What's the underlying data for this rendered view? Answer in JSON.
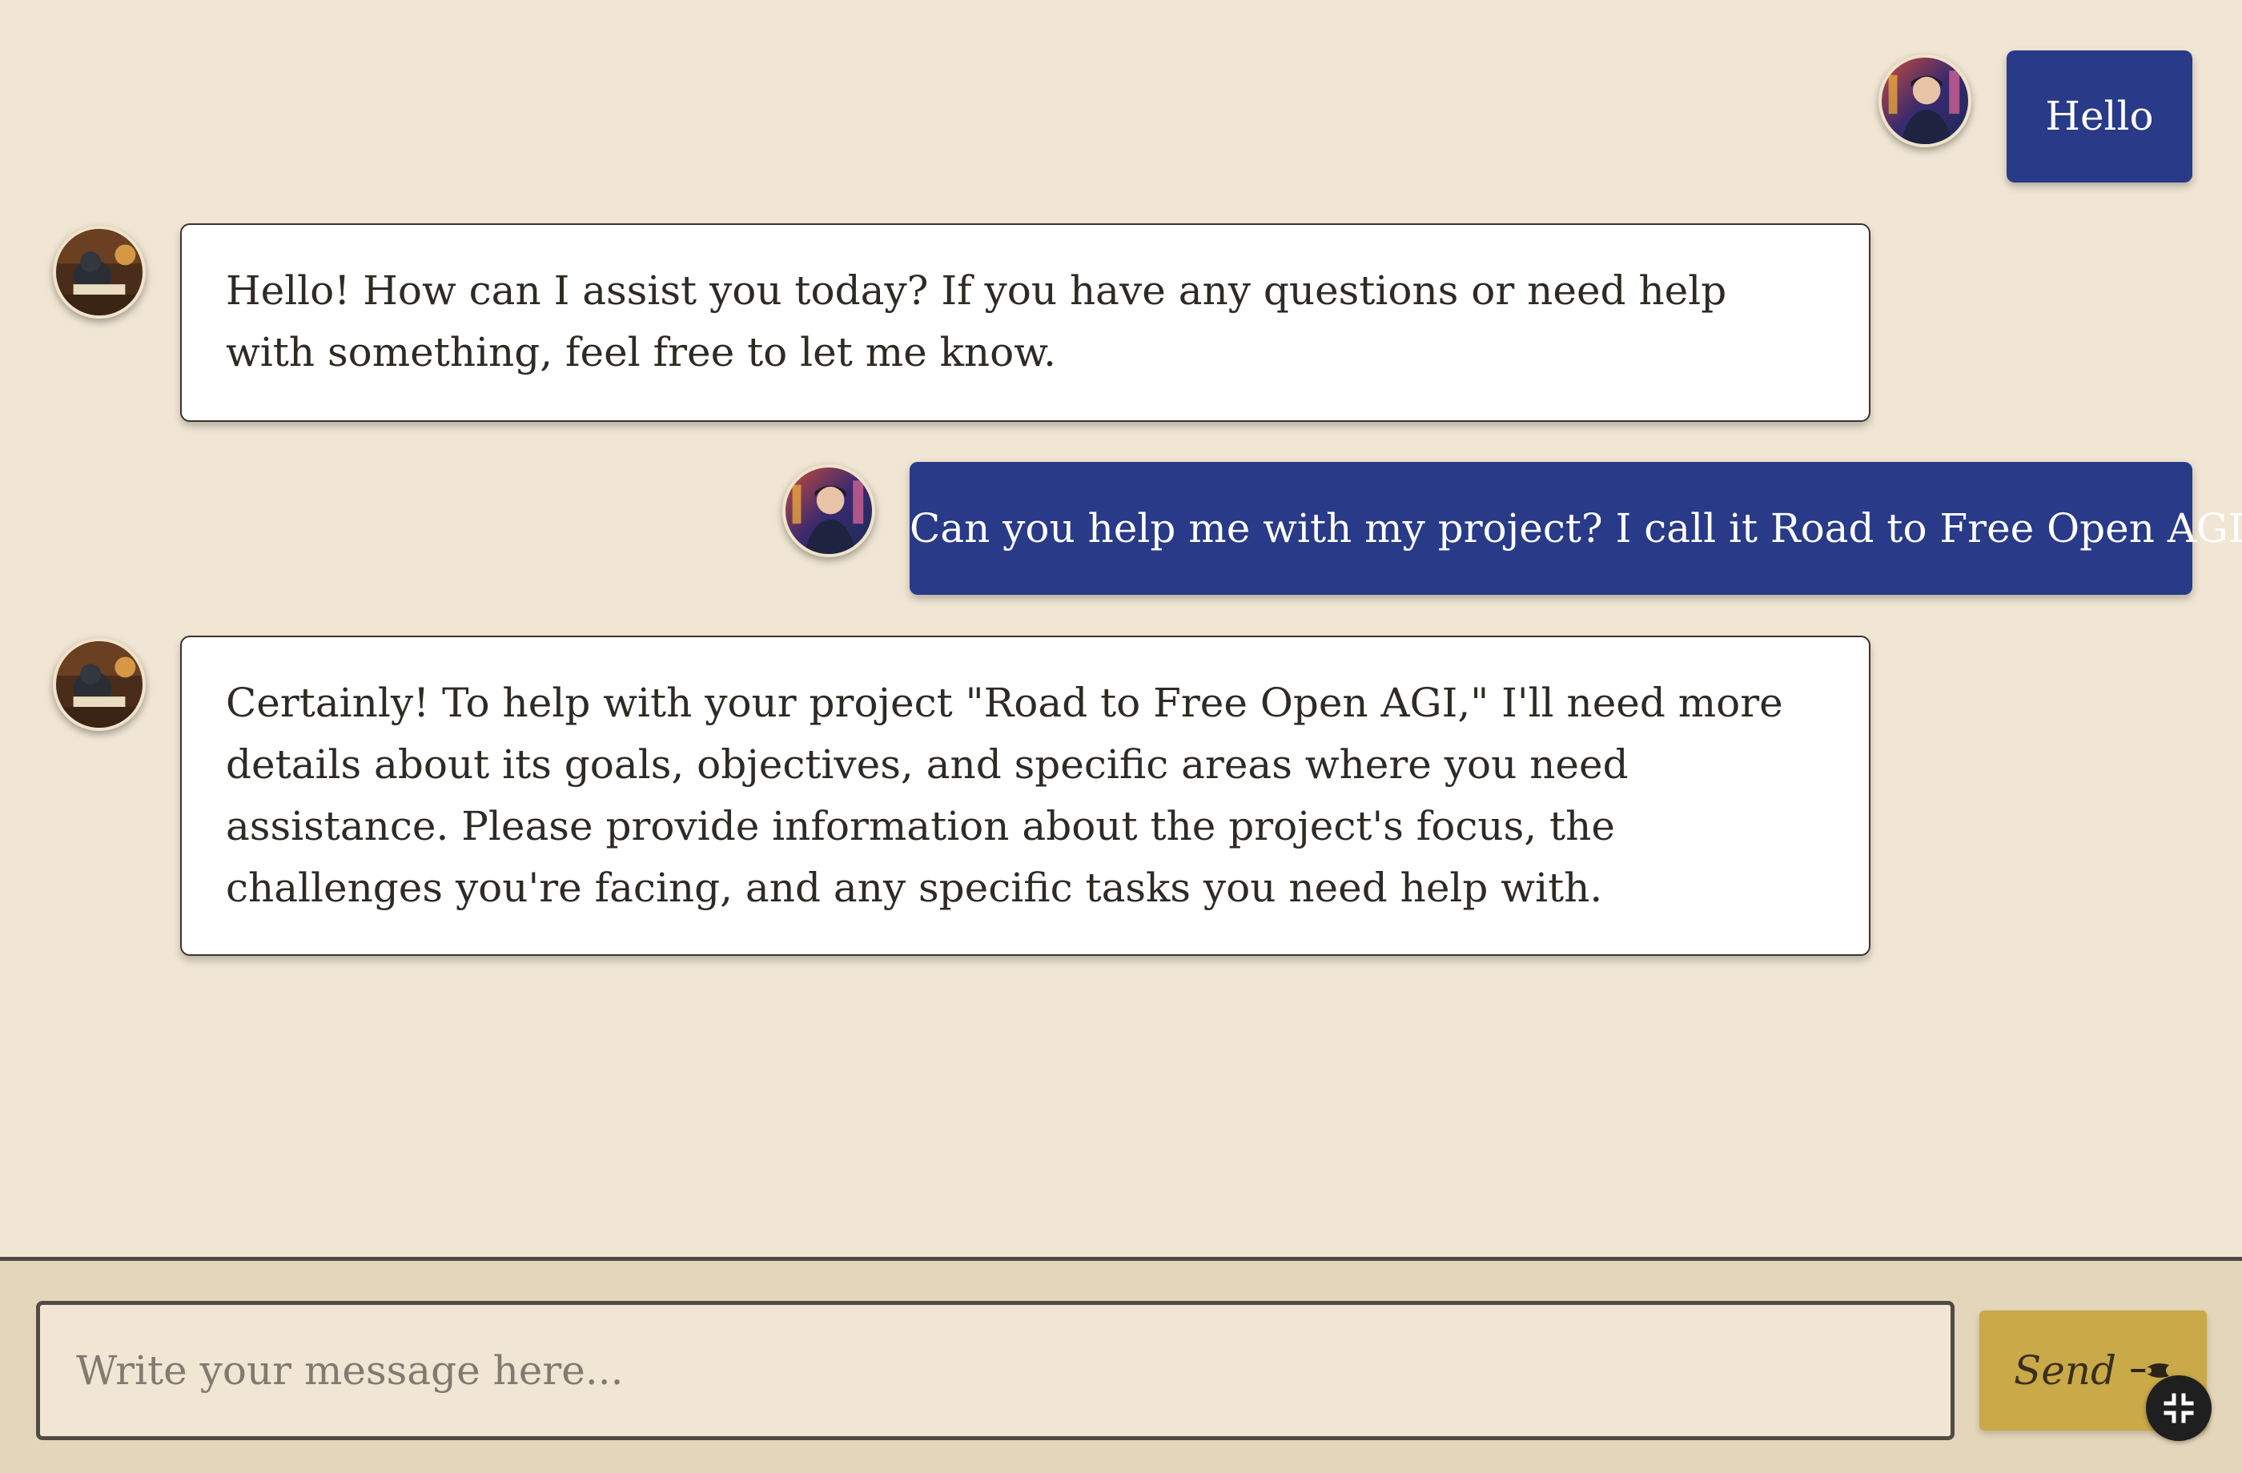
{
  "messages": [
    {
      "role": "user",
      "text": "Hello"
    },
    {
      "role": "assistant",
      "text": "Hello! How can I assist you today? If you have any questions or need help with something, feel free to let me know."
    },
    {
      "role": "user",
      "text": "Can you help me with my project? I call it Road to Free Open AGI."
    },
    {
      "role": "assistant",
      "text": "Certainly! To help with your project \"Road to Free Open AGI,\" I'll need more details about its goals, objectives, and specific areas where you need assistance. Please provide information about the project's focus, the challenges you're facing, and any specific tasks you need help with."
    }
  ],
  "composer": {
    "placeholder": "Write your message here...",
    "value": "",
    "send_label": "Send",
    "send_icon": "feather-quill-icon",
    "collapse_icon": "collapse-arrows-icon"
  },
  "colors": {
    "background": "#f1e6d4",
    "user_bubble": "#283a88",
    "assistant_bubble": "#ffffff",
    "send_button": "#c9a948",
    "footer": "#e4d6ba"
  }
}
